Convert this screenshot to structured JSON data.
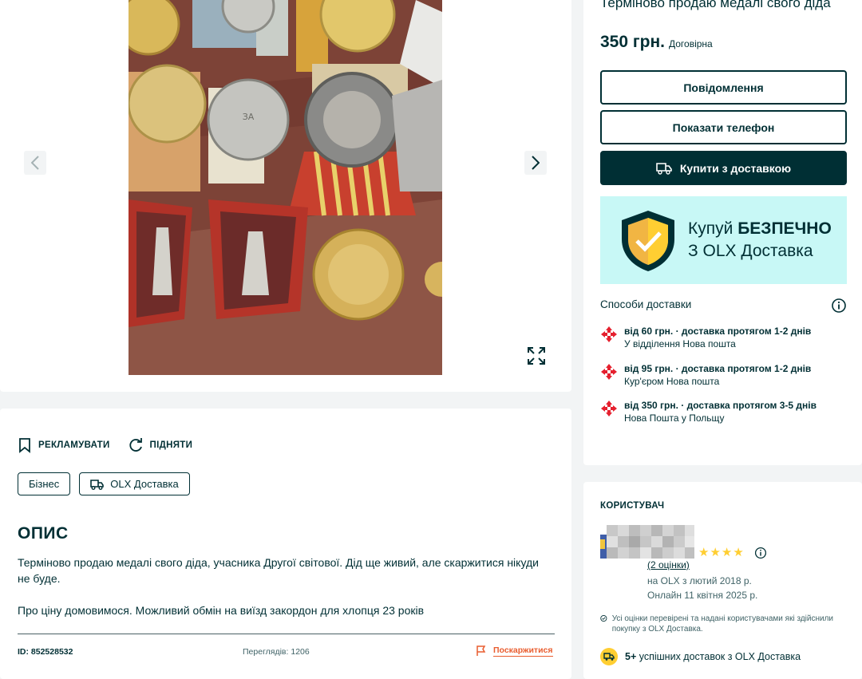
{
  "listing": {
    "title": "Терміново продаю медалі свого діда",
    "price": "350 грн.",
    "negotiable": "Договірна"
  },
  "buttons": {
    "message": "Повідомлення",
    "show_phone": "Показати телефон",
    "buy_delivery": "Купити з доставкою"
  },
  "promo": {
    "line1_prefix": "Купуй",
    "line1_bold": "БЕЗПЕЧНО",
    "line2": "З OLX Доставка"
  },
  "delivery": {
    "heading": "Способи доставки",
    "options": [
      {
        "title": "від 60 грн. · доставка протягом 1-2 днів",
        "subtitle": "У відділення Нова пошта"
      },
      {
        "title": "від 95 грн. · доставка протягом 1-2 днів",
        "subtitle": "Кур'єром Нова пошта"
      },
      {
        "title": "від 350 грн. · доставка протягом 3-5 днів",
        "subtitle": "Нова Пошта у Польщу"
      }
    ]
  },
  "ad_actions": {
    "promote": "РЕКЛАМУВАТИ",
    "raise": "ПІДНЯТИ"
  },
  "tags": {
    "business": "Бізнес",
    "olx_delivery": "OLX Доставка"
  },
  "description": {
    "heading": "ОПИС",
    "paragraph1": "Терміново продаю медалі свого діда, учасника Другої світової. Дід ще живий, але скаржитися нікуди не буде.",
    "paragraph2": "Про ціну домовимося. Можливий обмін на виїзд закордон для хлопця 23 років"
  },
  "footer": {
    "id": "ID: 852528532",
    "views": "Переглядів: 1206",
    "report": "Поскаржитися"
  },
  "user": {
    "heading": "КОРИСТУВАЧ",
    "ratings": "(2 оцінки)",
    "on_olx_since": "на OLX з лютий 2018 р.",
    "online": "Онлайн 11 квітня 2025 р.",
    "verified_note": "Усі оцінки перевірені та надані користувачами які здійснили покупку з OLX Доставка.",
    "deliveries_count": "5+",
    "deliveries_text": "успішних доставок з OLX Доставка",
    "rating_stars": 4
  },
  "colors": {
    "primary": "#002f34",
    "promo_bg": "#c8f8f6",
    "report": "#e95d2f",
    "star": "#ffce32",
    "nova_poshta": "#e5202e"
  }
}
